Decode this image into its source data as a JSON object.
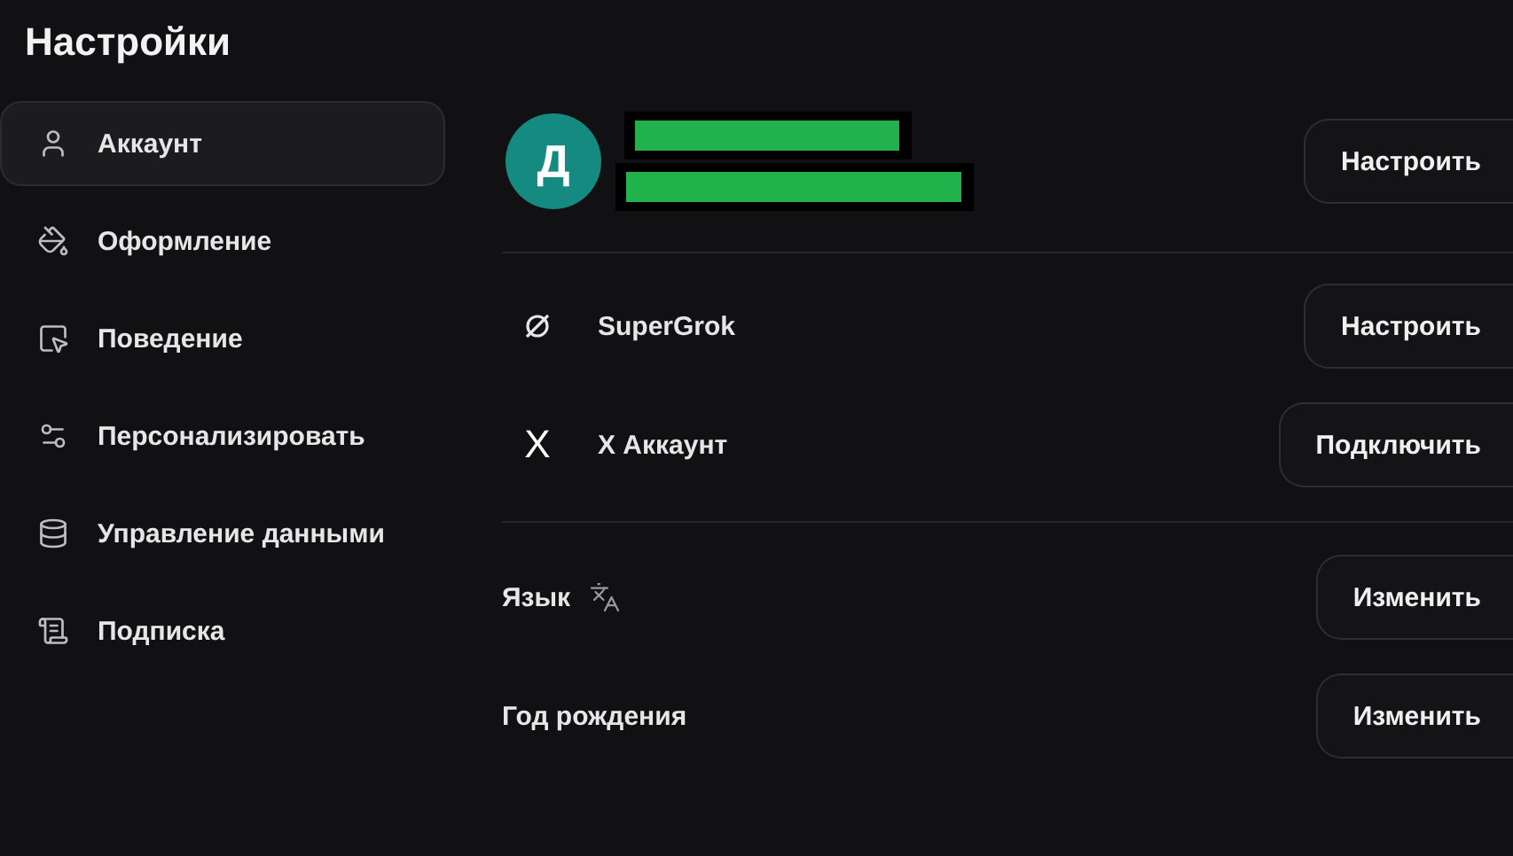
{
  "title": "Настройки",
  "sidebar": {
    "items": [
      {
        "label": "Аккаунт",
        "kind": "user",
        "selected": true
      },
      {
        "label": "Оформление",
        "kind": "paint",
        "selected": false
      },
      {
        "label": "Поведение",
        "kind": "pointer",
        "selected": false
      },
      {
        "label": "Персонализировать",
        "kind": "sliders",
        "selected": false
      },
      {
        "label": "Управление данными",
        "kind": "database",
        "selected": false
      },
      {
        "label": "Подписка",
        "kind": "scroll",
        "selected": false
      }
    ]
  },
  "account": {
    "avatar_letter": "Д",
    "redactions": [
      {
        "kind": "name",
        "color": "#22b24c"
      },
      {
        "kind": "email",
        "color": "#22b24c"
      }
    ],
    "button": "Настроить"
  },
  "services": [
    {
      "label": "SuperGrok",
      "kind": "grok",
      "button": "Настроить"
    },
    {
      "label": "X Аккаунт",
      "kind": "letter",
      "icon_text": "X",
      "button": "Подключить"
    }
  ],
  "preferences": [
    {
      "label": "Язык",
      "kind": "language",
      "button": "Изменить"
    },
    {
      "label": "Год рождения",
      "kind": "plain",
      "button": "Изменить"
    }
  ]
}
